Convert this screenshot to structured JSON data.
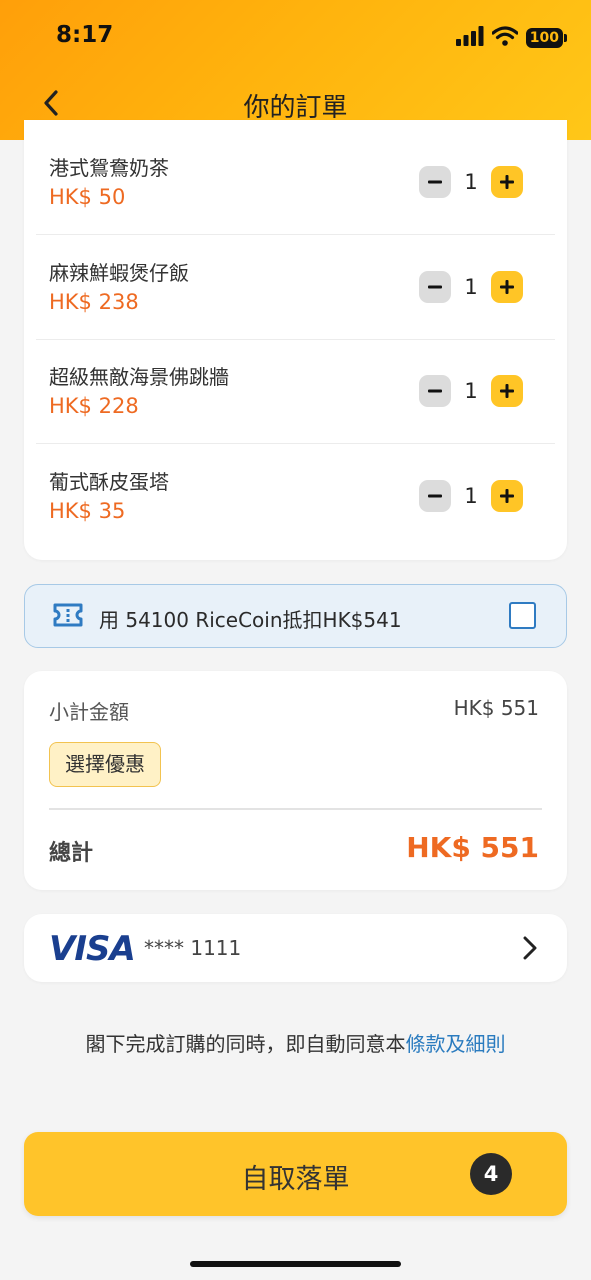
{
  "status_bar": {
    "time": "8:17",
    "battery": "100"
  },
  "header": {
    "title": "你的訂單",
    "back_icon": "chevron-left-icon"
  },
  "items": [
    {
      "name": "港式鴛鴦奶茶",
      "price": "HK$ 50",
      "qty": "1"
    },
    {
      "name": "麻辣鮮蝦煲仔飯",
      "price": "HK$ 238",
      "qty": "1"
    },
    {
      "name": "超級無敵海景佛跳牆",
      "price": "HK$ 228",
      "qty": "1"
    },
    {
      "name": "葡式酥皮蛋塔",
      "price": "HK$ 35",
      "qty": "1"
    }
  ],
  "ricecoin": {
    "text": "用 54100 RiceCoin抵扣HK$541",
    "checked": false,
    "icon": "ticket-icon"
  },
  "summary": {
    "subtotal_label": "小計金額",
    "subtotal_value": "HK$ 551",
    "promo_label": "選擇優惠",
    "total_label": "總計",
    "total_value": "HK$ 551"
  },
  "payment": {
    "brand": "VISA",
    "card_number": "**** 1111"
  },
  "terms": {
    "text": "閣下完成訂購的同時，即自動同意本",
    "link": "條款及細則"
  },
  "cta": {
    "label": "自取落單",
    "badge": "4"
  },
  "colors": {
    "accent": "#ffc42a",
    "price": "#ee6a22",
    "link": "#2a7bbf",
    "header_start": "#ff9f0a",
    "header_end": "#ffc718"
  }
}
